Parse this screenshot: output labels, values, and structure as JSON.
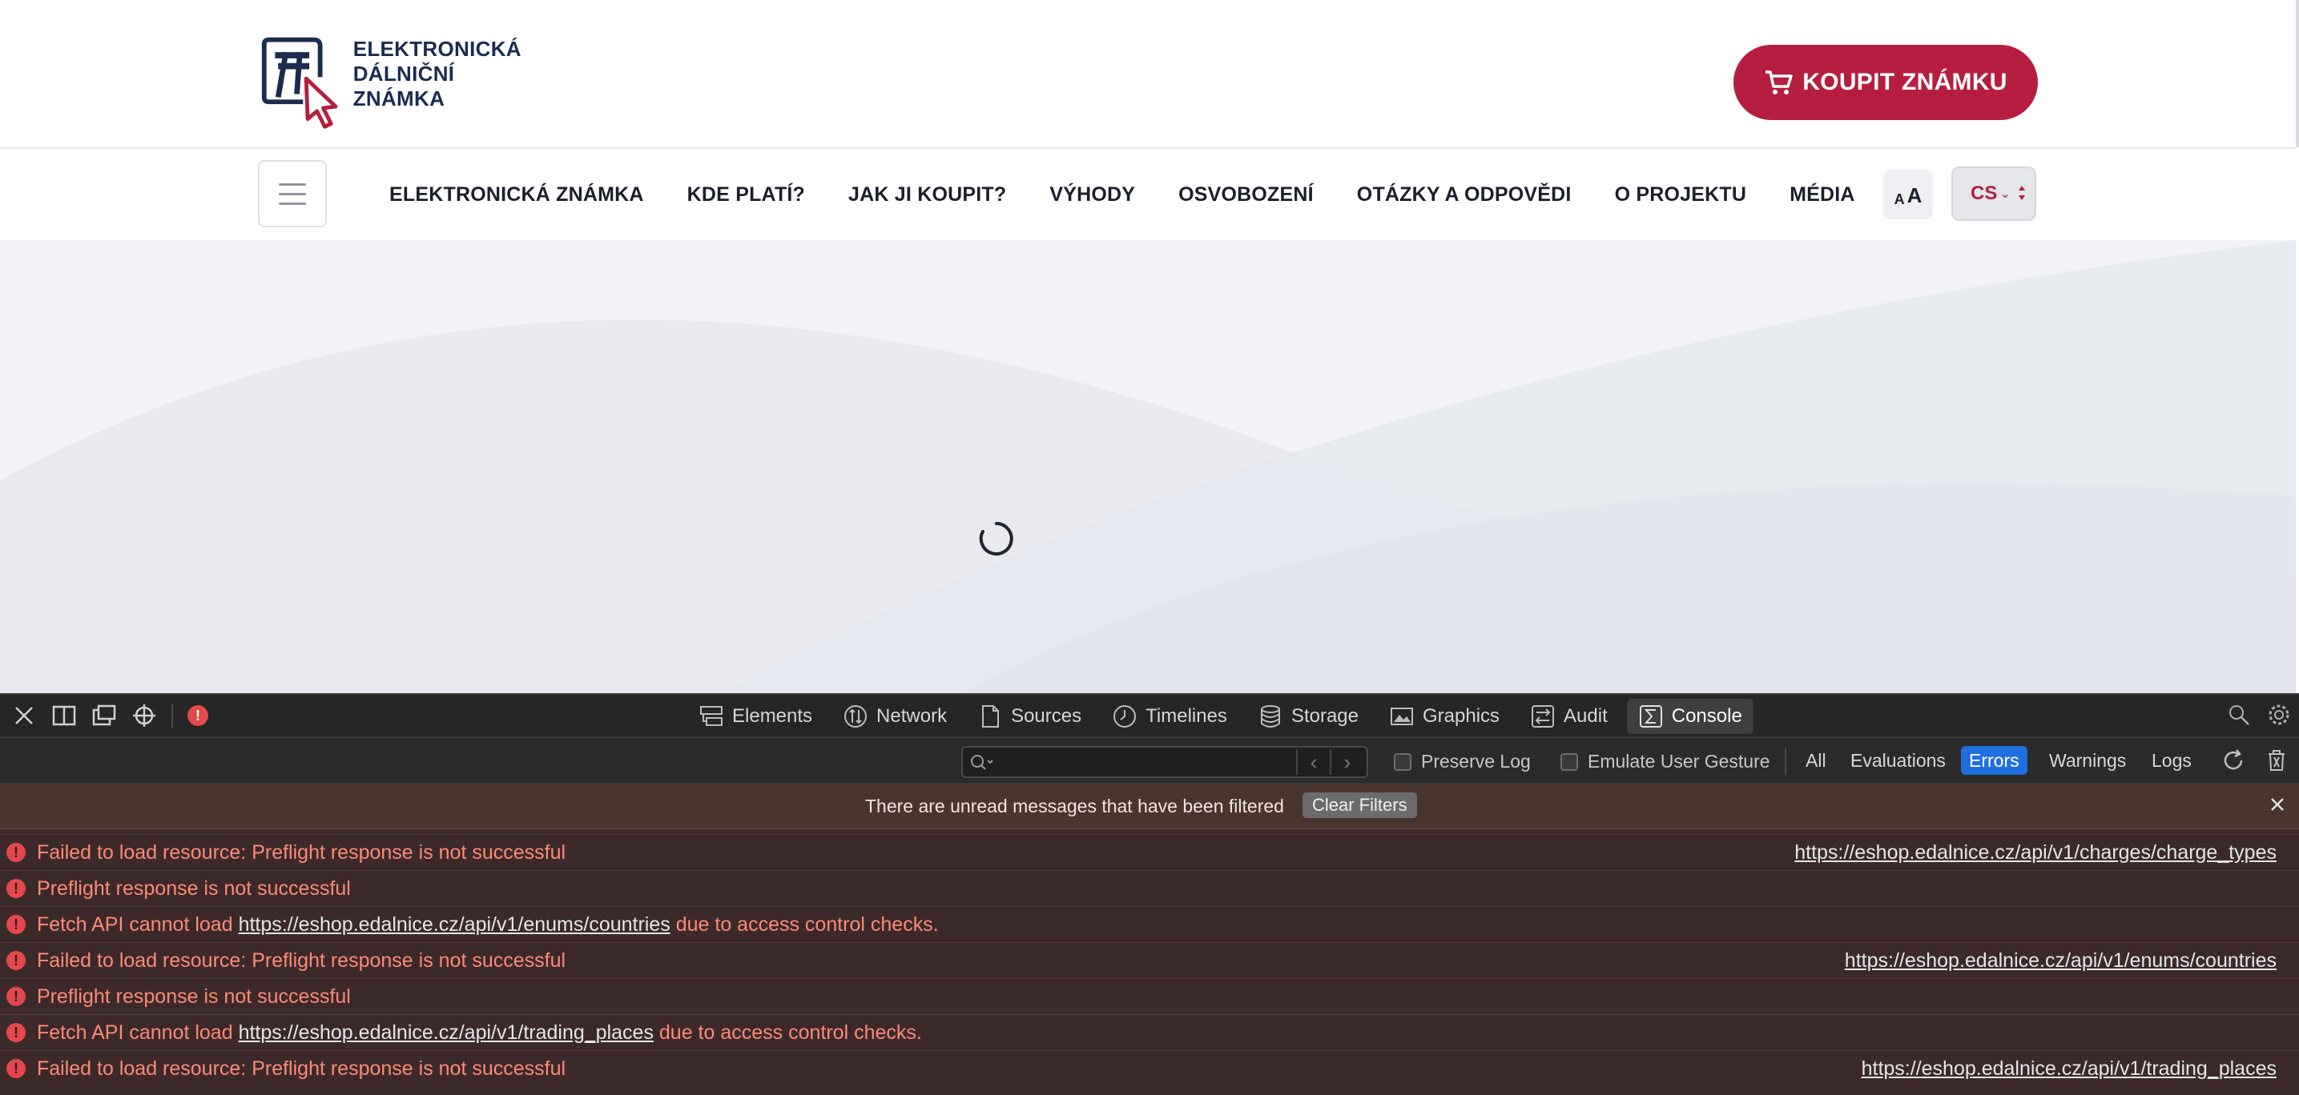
{
  "site": {
    "logo_line1": "ELEKTRONICKÁ",
    "logo_line2": "DÁLNIČNÍ ZNÁMKA",
    "buy_button": "KOUPIT ZNÁMKU",
    "nav": [
      "ELEKTRONICKÁ ZNÁMKA",
      "KDE PLATÍ?",
      "JAK JI KOUPIT?",
      "VÝHODY",
      "OSVOBOZENÍ",
      "OTÁZKY A ODPOVĚDI",
      "O PROJEKTU",
      "MÉDIA"
    ],
    "font_small": "A",
    "font_large": "A",
    "language": "CS"
  },
  "colors": {
    "brand_red": "#b51e3f",
    "brand_navy": "#1b2c4f",
    "error_text": "#ff8a73",
    "active_filter": "#1f6fe0"
  },
  "devtools": {
    "tabs": [
      "Elements",
      "Network",
      "Sources",
      "Timelines",
      "Storage",
      "Graphics",
      "Audit",
      "Console"
    ],
    "active_tab": "Console",
    "checkboxes": [
      "Preserve Log",
      "Emulate User Gesture"
    ],
    "levels": [
      "All",
      "Evaluations",
      "Errors",
      "Warnings",
      "Logs"
    ],
    "active_level": "Errors",
    "notice": "There are unread messages that have been filtered",
    "clear_filters": "Clear Filters",
    "messages": [
      {
        "text": "Failed to load resource: Preflight response is not successful",
        "source": "https://eshop.edalnice.cz/api/v1/charges/charge_types"
      },
      {
        "text": "Preflight response is not successful"
      },
      {
        "prefix": "Fetch API cannot load ",
        "link": "https://eshop.edalnice.cz/api/v1/enums/countries",
        "suffix": " due to access control checks."
      },
      {
        "text": "Failed to load resource: Preflight response is not successful",
        "source": "https://eshop.edalnice.cz/api/v1/enums/countries"
      },
      {
        "text": "Preflight response is not successful"
      },
      {
        "prefix": "Fetch API cannot load ",
        "link": "https://eshop.edalnice.cz/api/v1/trading_places",
        "suffix": " due to access control checks."
      },
      {
        "text": "Failed to load resource: Preflight response is not successful",
        "source": "https://eshop.edalnice.cz/api/v1/trading_places"
      }
    ]
  }
}
